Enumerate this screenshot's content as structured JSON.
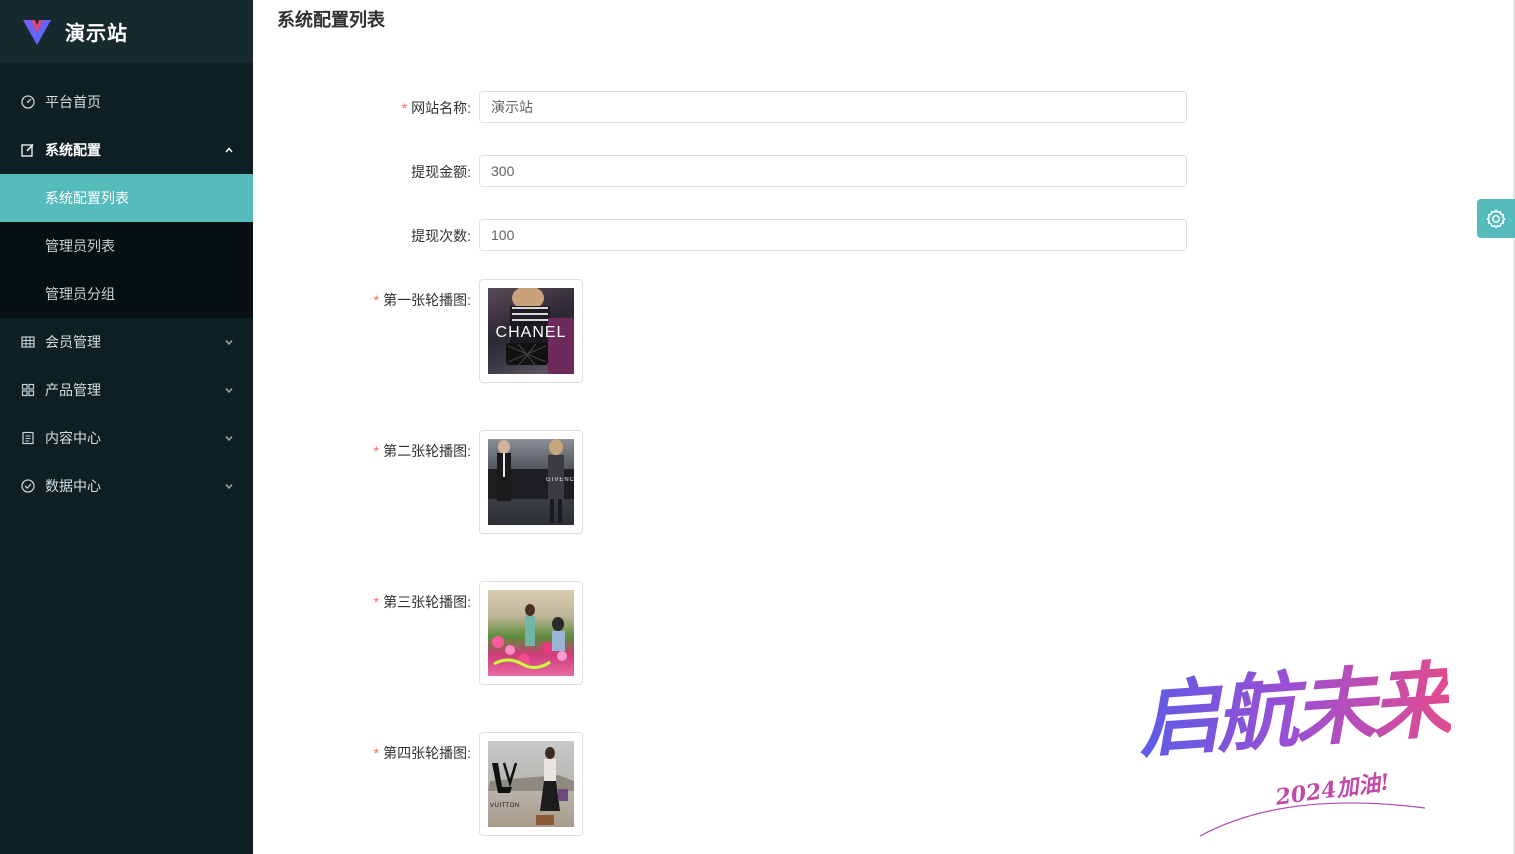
{
  "brand": {
    "name": "演示站",
    "accent": "#55bcbb"
  },
  "sidebar": {
    "items": [
      {
        "label": "平台首页",
        "icon": "dashboard-icon"
      },
      {
        "label": "系统配置",
        "icon": "edit-icon",
        "expanded": true,
        "children": [
          {
            "label": "系统配置列表",
            "active": true
          },
          {
            "label": "管理员列表"
          },
          {
            "label": "管理员分组"
          }
        ]
      },
      {
        "label": "会员管理",
        "icon": "grid-icon"
      },
      {
        "label": "产品管理",
        "icon": "apps-icon"
      },
      {
        "label": "内容中心",
        "icon": "document-icon"
      },
      {
        "label": "数据中心",
        "icon": "check-circle-icon"
      }
    ]
  },
  "main": {
    "title": "系统配置列表",
    "form": {
      "site_name": {
        "label": "网站名称:",
        "value": "演示站",
        "required": true
      },
      "withdraw_amount": {
        "label": "提现金额:",
        "value": "300",
        "required": false
      },
      "withdraw_count": {
        "label": "提现次数:",
        "value": "100",
        "required": false
      },
      "banner1": {
        "label": "第一张轮播图:",
        "required": true,
        "image_text": "CHANEL"
      },
      "banner2": {
        "label": "第二张轮播图:",
        "required": true,
        "image_text": "GIVENCHY"
      },
      "banner3": {
        "label": "第三张轮播图:",
        "required": true
      },
      "banner4": {
        "label": "第四张轮播图:",
        "required": true,
        "image_text": "VUITTON"
      }
    }
  },
  "watermark": {
    "main": "启航未来",
    "sub": "2024加油!"
  }
}
